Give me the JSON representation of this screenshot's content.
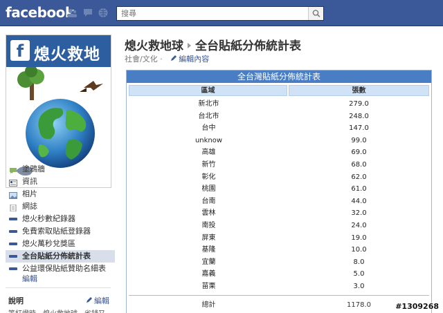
{
  "topbar": {
    "logo": "facebook",
    "search_placeholder": "搜尋"
  },
  "profile": {
    "title": "熄火救地球",
    "f_letter": "f"
  },
  "sidebar": {
    "items": [
      {
        "label": "塗鴉牆",
        "icon": "wall-icon"
      },
      {
        "label": "資訊",
        "icon": "info-icon"
      },
      {
        "label": "相片",
        "icon": "photos-icon"
      },
      {
        "label": "網誌",
        "icon": "notes-icon"
      },
      {
        "label": "熄火秒數紀錄器",
        "icon": "app-icon"
      },
      {
        "label": "免費索取貼紙登錄器",
        "icon": "app-icon"
      },
      {
        "label": "熄火萬秒兌獎區",
        "icon": "app-icon"
      },
      {
        "label": "全台貼紙分佈統計表",
        "icon": "app-icon",
        "active": true
      },
      {
        "label": "公益環保貼紙贊助名細表",
        "icon": "app-icon"
      }
    ],
    "edit_label": "編輯",
    "about_heading": "說明",
    "about_edit": "編輯",
    "about_text": "等紅燈時，熄火救地球，省錢又"
  },
  "main": {
    "page_name": "熄火救地球",
    "tab_name": "全台貼紙分佈統計表",
    "category": "社會/文化",
    "edit_info": "編輯內容",
    "table": {
      "caption": "全台灣貼紙分佈統計表",
      "col_region": "區域",
      "col_count": "張數",
      "rows": [
        {
          "region": "新北市",
          "count": "279.0"
        },
        {
          "region": "台北市",
          "count": "248.0"
        },
        {
          "region": "台中",
          "count": "147.0"
        },
        {
          "region": "unknow",
          "count": "99.0"
        },
        {
          "region": "高雄",
          "count": "69.0"
        },
        {
          "region": "新竹",
          "count": "68.0"
        },
        {
          "region": "彰化",
          "count": "62.0"
        },
        {
          "region": "桃園",
          "count": "61.0"
        },
        {
          "region": "台南",
          "count": "44.0"
        },
        {
          "region": "雲林",
          "count": "32.0"
        },
        {
          "region": "南投",
          "count": "24.0"
        },
        {
          "region": "屏東",
          "count": "19.0"
        },
        {
          "region": "基隆",
          "count": "10.0"
        },
        {
          "region": "宜蘭",
          "count": "8.0"
        },
        {
          "region": "嘉義",
          "count": "5.0"
        },
        {
          "region": "苗栗",
          "count": "3.0"
        }
      ],
      "total_label": "總計",
      "total_value": "1178.0"
    }
  },
  "watermark": "#1309268",
  "colors": {
    "facebook_blue": "#3b5998",
    "table_caption": "#4a7ec4",
    "table_header": "#cfe2f6",
    "active_nav": "#d8dfea"
  }
}
